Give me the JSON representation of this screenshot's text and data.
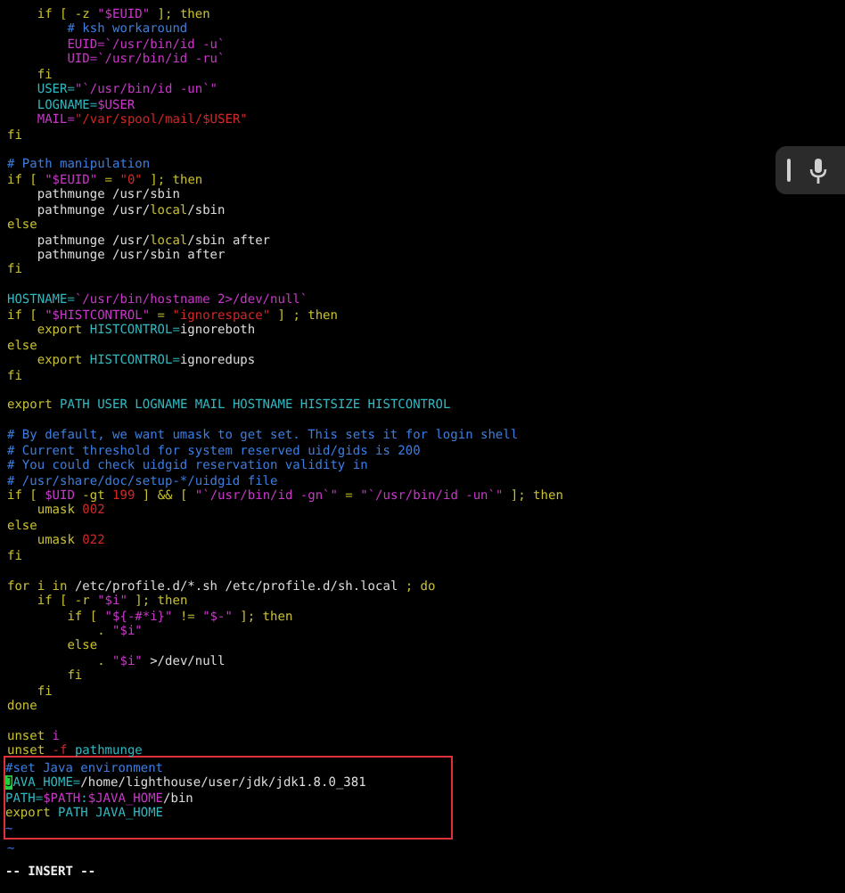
{
  "editor": {
    "blocks": [
      {
        "highlighted": false,
        "lines": [
          {
            "kind": "code",
            "segments": [
              {
                "kind": "keyword",
                "text": "    if [ -z "
              },
              {
                "kind": "string",
                "text": "\"$EUID\""
              },
              {
                "kind": "keyword",
                "text": " ]; then"
              }
            ]
          },
          {
            "kind": "code",
            "segments": [
              {
                "kind": "comment",
                "text": "        # ksh workaround"
              }
            ]
          },
          {
            "kind": "code",
            "segments": [
              {
                "kind": "string",
                "text": "        EUID=`/usr/bin/id -u`"
              }
            ]
          },
          {
            "kind": "code",
            "segments": [
              {
                "kind": "string",
                "text": "        UID=`/usr/bin/id -ru`"
              }
            ]
          },
          {
            "kind": "code",
            "segments": [
              {
                "kind": "keyword",
                "text": "    fi"
              }
            ]
          },
          {
            "kind": "code",
            "segments": [
              {
                "kind": "variable",
                "text": "    USER="
              },
              {
                "kind": "string",
                "text": "\"`/usr/bin/id -un`\""
              }
            ]
          },
          {
            "kind": "code",
            "segments": [
              {
                "kind": "variable",
                "text": "    LOGNAME="
              },
              {
                "kind": "string",
                "text": "$USER"
              }
            ]
          },
          {
            "kind": "code",
            "segments": [
              {
                "kind": "string",
                "text": "    MAIL="
              },
              {
                "kind": "number",
                "text": "\"/var/spool/mail/$USER\""
              }
            ]
          },
          {
            "kind": "code",
            "segments": [
              {
                "kind": "keyword",
                "text": "fi"
              }
            ]
          },
          {
            "kind": "blank"
          },
          {
            "kind": "code",
            "segments": [
              {
                "kind": "comment",
                "text": "# Path manipulation"
              }
            ]
          },
          {
            "kind": "code",
            "segments": [
              {
                "kind": "keyword",
                "text": "if [ "
              },
              {
                "kind": "string",
                "text": "\"$EUID\""
              },
              {
                "kind": "keyword",
                "text": " = "
              },
              {
                "kind": "number",
                "text": "\"0\""
              },
              {
                "kind": "keyword",
                "text": " ]; then"
              }
            ]
          },
          {
            "kind": "code",
            "segments": [
              {
                "kind": "plain",
                "text": "    pathmunge /usr/sbin"
              }
            ]
          },
          {
            "kind": "code",
            "segments": [
              {
                "kind": "plain",
                "text": "    pathmunge /usr/"
              },
              {
                "kind": "keyword",
                "text": "local"
              },
              {
                "kind": "plain",
                "text": "/sbin"
              }
            ]
          },
          {
            "kind": "code",
            "segments": [
              {
                "kind": "keyword",
                "text": "else"
              }
            ]
          },
          {
            "kind": "code",
            "segments": [
              {
                "kind": "plain",
                "text": "    pathmunge /usr/"
              },
              {
                "kind": "keyword",
                "text": "local"
              },
              {
                "kind": "plain",
                "text": "/sbin after"
              }
            ]
          },
          {
            "kind": "code",
            "segments": [
              {
                "kind": "plain",
                "text": "    pathmunge /usr/sbin after"
              }
            ]
          },
          {
            "kind": "code",
            "segments": [
              {
                "kind": "keyword",
                "text": "fi"
              }
            ]
          },
          {
            "kind": "blank"
          },
          {
            "kind": "code",
            "segments": [
              {
                "kind": "variable",
                "text": "HOSTNAME="
              },
              {
                "kind": "string",
                "text": "`/usr/bin/hostname 2>/dev/null`"
              }
            ]
          },
          {
            "kind": "code",
            "segments": [
              {
                "kind": "keyword",
                "text": "if [ "
              },
              {
                "kind": "string",
                "text": "\"$HISTCONTROL\""
              },
              {
                "kind": "keyword",
                "text": " = "
              },
              {
                "kind": "number",
                "text": "\"ignorespace\""
              },
              {
                "kind": "keyword",
                "text": " ] ; then"
              }
            ]
          },
          {
            "kind": "code",
            "segments": [
              {
                "kind": "keyword",
                "text": "    export "
              },
              {
                "kind": "variable",
                "text": "HISTCONTROL="
              },
              {
                "kind": "plain",
                "text": "ignoreboth"
              }
            ]
          },
          {
            "kind": "code",
            "segments": [
              {
                "kind": "keyword",
                "text": "else"
              }
            ]
          },
          {
            "kind": "code",
            "segments": [
              {
                "kind": "keyword",
                "text": "    export "
              },
              {
                "kind": "variable",
                "text": "HISTCONTROL="
              },
              {
                "kind": "plain",
                "text": "ignoredups"
              }
            ]
          },
          {
            "kind": "code",
            "segments": [
              {
                "kind": "keyword",
                "text": "fi"
              }
            ]
          },
          {
            "kind": "blank"
          },
          {
            "kind": "code",
            "segments": [
              {
                "kind": "keyword",
                "text": "export "
              },
              {
                "kind": "variable",
                "text": "PATH USER LOGNAME MAIL HOSTNAME HISTSIZE HISTCONTROL"
              }
            ]
          },
          {
            "kind": "blank"
          },
          {
            "kind": "code",
            "segments": [
              {
                "kind": "comment",
                "text": "# By default, we want umask to get set. This sets it for login shell"
              }
            ]
          },
          {
            "kind": "code",
            "segments": [
              {
                "kind": "comment",
                "text": "# Current threshold for system reserved uid/gids is 200"
              }
            ]
          },
          {
            "kind": "code",
            "segments": [
              {
                "kind": "comment",
                "text": "# You could check uidgid reservation validity in"
              }
            ]
          },
          {
            "kind": "code",
            "segments": [
              {
                "kind": "comment",
                "text": "# /usr/share/doc/setup-*/uidgid file"
              }
            ]
          },
          {
            "kind": "code",
            "segments": [
              {
                "kind": "keyword",
                "text": "if [ "
              },
              {
                "kind": "string",
                "text": "$UID"
              },
              {
                "kind": "keyword",
                "text": " -gt "
              },
              {
                "kind": "number",
                "text": "199"
              },
              {
                "kind": "keyword",
                "text": " ] && [ "
              },
              {
                "kind": "string",
                "text": "\"`/usr/bin/id -gn`\""
              },
              {
                "kind": "keyword",
                "text": " = "
              },
              {
                "kind": "string",
                "text": "\"`/usr/bin/id -un`\""
              },
              {
                "kind": "keyword",
                "text": " ]; then"
              }
            ]
          },
          {
            "kind": "code",
            "segments": [
              {
                "kind": "keyword",
                "text": "    umask "
              },
              {
                "kind": "number",
                "text": "002"
              }
            ]
          },
          {
            "kind": "code",
            "segments": [
              {
                "kind": "keyword",
                "text": "else"
              }
            ]
          },
          {
            "kind": "code",
            "segments": [
              {
                "kind": "keyword",
                "text": "    umask "
              },
              {
                "kind": "number",
                "text": "022"
              }
            ]
          },
          {
            "kind": "code",
            "segments": [
              {
                "kind": "keyword",
                "text": "fi"
              }
            ]
          },
          {
            "kind": "blank"
          },
          {
            "kind": "code",
            "segments": [
              {
                "kind": "keyword",
                "text": "for i in "
              },
              {
                "kind": "plain",
                "text": "/etc/profile.d/*.sh /etc/profile.d/sh.local"
              },
              {
                "kind": "keyword",
                "text": " ; do"
              }
            ]
          },
          {
            "kind": "code",
            "segments": [
              {
                "kind": "keyword",
                "text": "    if [ -r "
              },
              {
                "kind": "string",
                "text": "\"$i\""
              },
              {
                "kind": "keyword",
                "text": " ]; then"
              }
            ]
          },
          {
            "kind": "code",
            "segments": [
              {
                "kind": "keyword",
                "text": "        if [ "
              },
              {
                "kind": "string",
                "text": "\"${-#*i}\""
              },
              {
                "kind": "keyword",
                "text": " != "
              },
              {
                "kind": "string",
                "text": "\"$-\""
              },
              {
                "kind": "keyword",
                "text": " ]; then"
              }
            ]
          },
          {
            "kind": "code",
            "segments": [
              {
                "kind": "keyword",
                "text": "            . "
              },
              {
                "kind": "string",
                "text": "\"$i\""
              }
            ]
          },
          {
            "kind": "code",
            "segments": [
              {
                "kind": "keyword",
                "text": "        else"
              }
            ]
          },
          {
            "kind": "code",
            "segments": [
              {
                "kind": "keyword",
                "text": "            . "
              },
              {
                "kind": "string",
                "text": "\"$i\""
              },
              {
                "kind": "plain",
                "text": " >/dev/null"
              }
            ]
          },
          {
            "kind": "code",
            "segments": [
              {
                "kind": "keyword",
                "text": "        fi"
              }
            ]
          },
          {
            "kind": "code",
            "segments": [
              {
                "kind": "keyword",
                "text": "    fi"
              }
            ]
          },
          {
            "kind": "code",
            "segments": [
              {
                "kind": "keyword",
                "text": "done"
              }
            ]
          },
          {
            "kind": "blank"
          },
          {
            "kind": "code",
            "segments": [
              {
                "kind": "keyword",
                "text": "unset "
              },
              {
                "kind": "string",
                "text": "i"
              }
            ]
          },
          {
            "kind": "code",
            "segments": [
              {
                "kind": "keyword",
                "text": "unset "
              },
              {
                "kind": "number",
                "text": "-f"
              },
              {
                "kind": "variable",
                "text": " pathmunge"
              }
            ]
          }
        ]
      },
      {
        "highlighted": true,
        "lines": [
          {
            "kind": "code",
            "segments": [
              {
                "kind": "comment",
                "text": "#set Java environment"
              }
            ]
          },
          {
            "kind": "code",
            "segments": [
              {
                "kind": "cursor",
                "text": "J"
              },
              {
                "kind": "variable",
                "text": "AVA_HOME="
              },
              {
                "kind": "plain",
                "text": "/home/lighthouse/user/jdk/jdk1.8.0_381"
              }
            ]
          },
          {
            "kind": "code",
            "segments": [
              {
                "kind": "variable",
                "text": "PATH="
              },
              {
                "kind": "string",
                "text": "$PATH"
              },
              {
                "kind": "variable",
                "text": ":"
              },
              {
                "kind": "string",
                "text": "$JAVA_HOME"
              },
              {
                "kind": "plain",
                "text": "/bin"
              }
            ]
          },
          {
            "kind": "code",
            "segments": [
              {
                "kind": "keyword",
                "text": "export "
              },
              {
                "kind": "variable",
                "text": "PATH JAVA_HOME"
              }
            ]
          },
          {
            "kind": "tilde",
            "text": "~"
          }
        ]
      },
      {
        "highlighted": false,
        "lines": [
          {
            "kind": "tilde",
            "text": "~"
          }
        ]
      }
    ]
  },
  "status_bar": {
    "mode": "-- INSERT --"
  }
}
